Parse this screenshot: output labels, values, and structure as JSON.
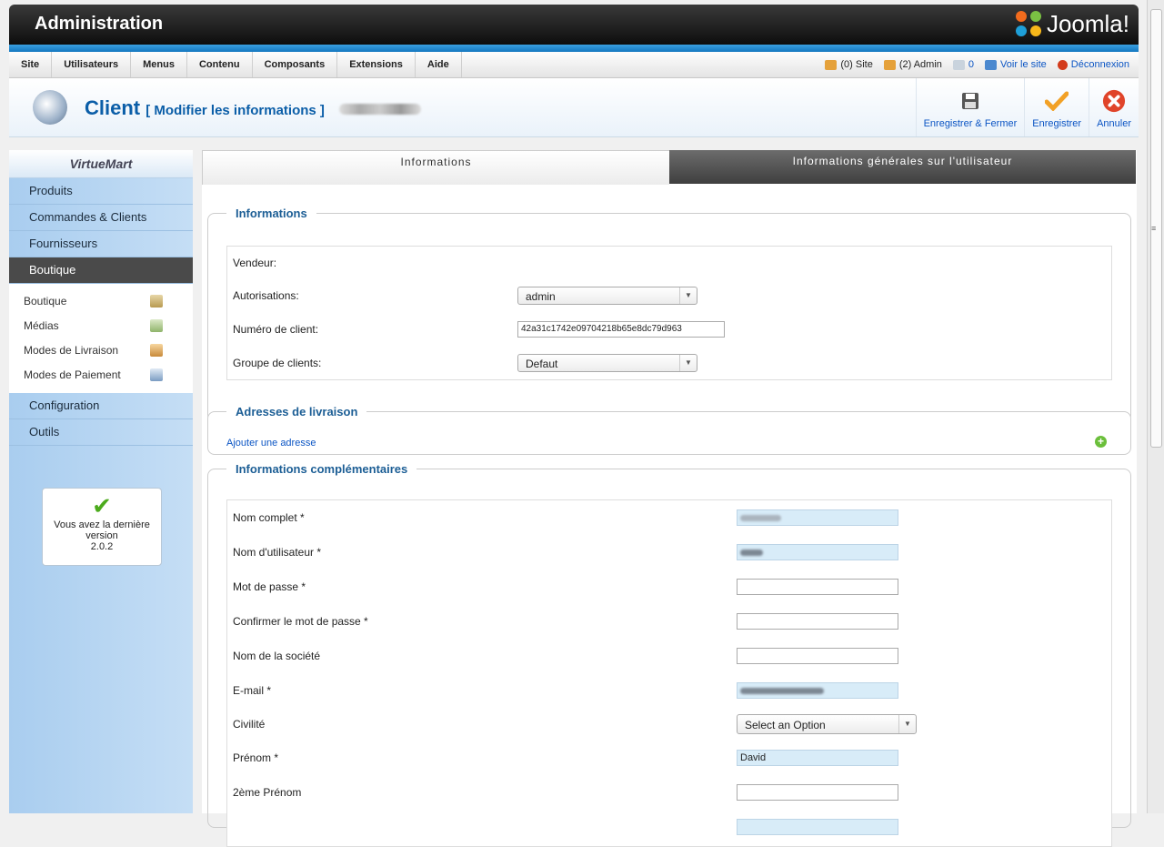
{
  "header": {
    "title": "Administration",
    "logo_text": "Joomla!"
  },
  "menu": [
    "Site",
    "Utilisateurs",
    "Menus",
    "Contenu",
    "Composants",
    "Extensions",
    "Aide"
  ],
  "status": {
    "site": "(0) Site",
    "admin": "(2) Admin",
    "messages": "0",
    "view_site": "Voir le site",
    "logout": "Déconnexion"
  },
  "toolbar": {
    "title": "Client",
    "subtitle": "[ Modifier les informations ]",
    "save_close": "Enregistrer & Fermer",
    "save": "Enregistrer",
    "cancel": "Annuler"
  },
  "sidebar": {
    "logo": "VirtueMart",
    "items": [
      "Produits",
      "Commandes & Clients",
      "Fournisseurs",
      "Boutique"
    ],
    "sub_items": [
      "Boutique",
      "Médias",
      "Modes de Livraison",
      "Modes de Paiement"
    ],
    "items_after": [
      "Configuration",
      "Outils"
    ],
    "version_line1": "Vous avez la dernière version",
    "version_number": "2.0.2"
  },
  "tabs": [
    "Informations",
    "Informations générales sur l'utilisateur"
  ],
  "info": {
    "legend": "Informations",
    "vendor_label": "Vendeur:",
    "perms_label": "Autorisations:",
    "perms_value": "admin",
    "customer_no_label": "Numéro de client:",
    "customer_no_value": "42a31c1742e09704218b65e8dc79d963",
    "group_label": "Groupe de clients:",
    "group_value": "Defaut"
  },
  "shipping": {
    "legend": "Adresses de livraison",
    "add_link": "Ajouter une adresse"
  },
  "extra": {
    "legend": "Informations complémentaires",
    "fields": [
      {
        "label": "Nom complet *"
      },
      {
        "label": "Nom d'utilisateur *"
      },
      {
        "label": "Mot de passe *"
      },
      {
        "label": "Confirmer le mot de passe *"
      },
      {
        "label": "Nom de la société"
      },
      {
        "label": "E-mail *"
      },
      {
        "label": "Civilité",
        "select": "Select an Option"
      },
      {
        "label": "Prénom *",
        "value": "David"
      },
      {
        "label": "2ème Prénom"
      }
    ]
  }
}
